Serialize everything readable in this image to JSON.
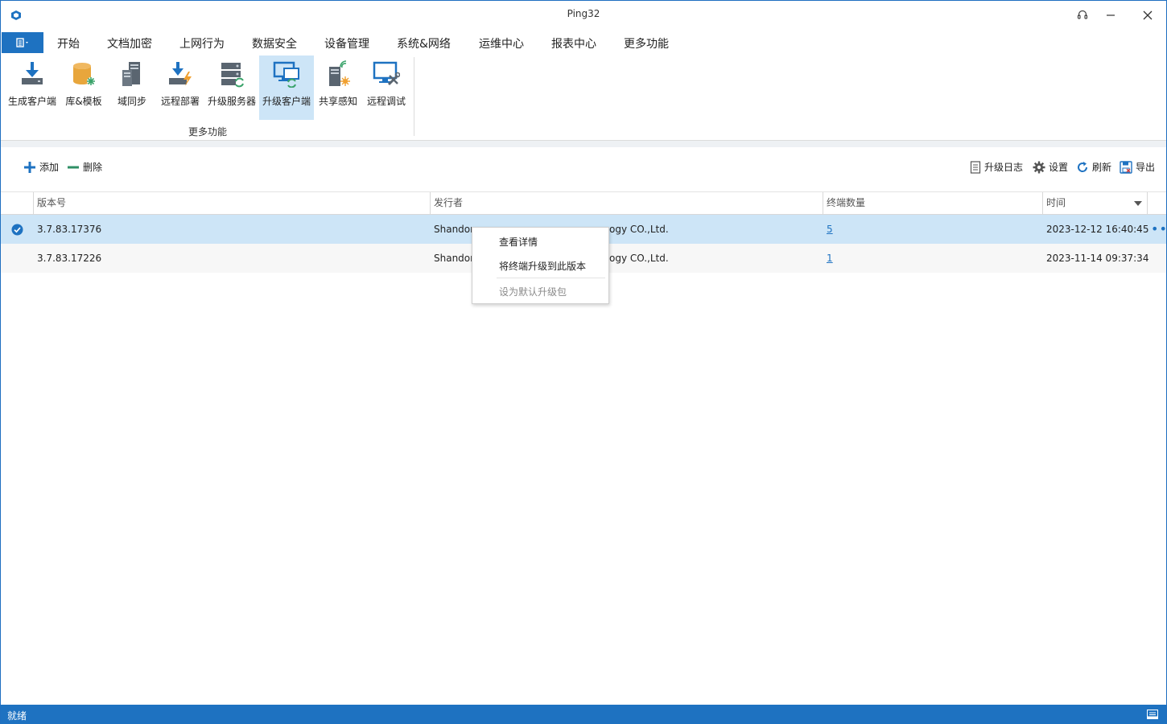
{
  "window": {
    "title": "Ping32"
  },
  "tabs": [
    {
      "label": "开始",
      "active": false
    },
    {
      "label": "文档加密",
      "active": false
    },
    {
      "label": "上网行为",
      "active": false
    },
    {
      "label": "数据安全",
      "active": false
    },
    {
      "label": "设备管理",
      "active": false
    },
    {
      "label": "系统&网络",
      "active": false
    },
    {
      "label": "运维中心",
      "active": false
    },
    {
      "label": "报表中心",
      "active": false
    },
    {
      "label": "更多功能",
      "active": true
    }
  ],
  "ribbon": {
    "buttons": [
      {
        "label": "生成客户端",
        "icon": "download-client-icon"
      },
      {
        "label": "库&模板",
        "icon": "database-template-icon"
      },
      {
        "label": "域同步",
        "icon": "domain-sync-icon"
      },
      {
        "label": "远程部署",
        "icon": "remote-deploy-icon"
      },
      {
        "label": "升级服务器",
        "icon": "upgrade-server-icon"
      },
      {
        "label": "升级客户端",
        "icon": "upgrade-client-icon",
        "selected": true
      },
      {
        "label": "共享感知",
        "icon": "share-aware-icon"
      },
      {
        "label": "远程调试",
        "icon": "remote-debug-icon"
      }
    ],
    "group_label": "更多功能"
  },
  "toolbar": {
    "add_label": "添加",
    "delete_label": "删除",
    "upgrade_log_label": "升级日志",
    "settings_label": "设置",
    "refresh_label": "刷新",
    "export_label": "导出"
  },
  "grid": {
    "columns": [
      "版本号",
      "发行者",
      "终端数量",
      "时间"
    ],
    "rows": [
      {
        "version": "3.7.83.17376",
        "publisher_left": "Shandon",
        "publisher_right": "ogy CO.,Ltd.",
        "count": "5",
        "time": "2023-12-12 16:40:45",
        "selected": true
      },
      {
        "version": "3.7.83.17226",
        "publisher_left": "Shandon",
        "publisher_right": "ogy CO.,Ltd.",
        "count": "1",
        "time": "2023-11-14 09:37:34",
        "selected": false
      }
    ]
  },
  "context_menu": {
    "items": [
      {
        "label": "查看详情",
        "enabled": true
      },
      {
        "label": "将终端升级到此版本",
        "enabled": true
      },
      {
        "label": "设为默认升级包",
        "enabled": false
      }
    ]
  },
  "status": {
    "text": "就绪"
  },
  "colors": {
    "accent": "#1e72c1",
    "selection": "#cde5f7",
    "statusbar": "#1e72c1"
  }
}
